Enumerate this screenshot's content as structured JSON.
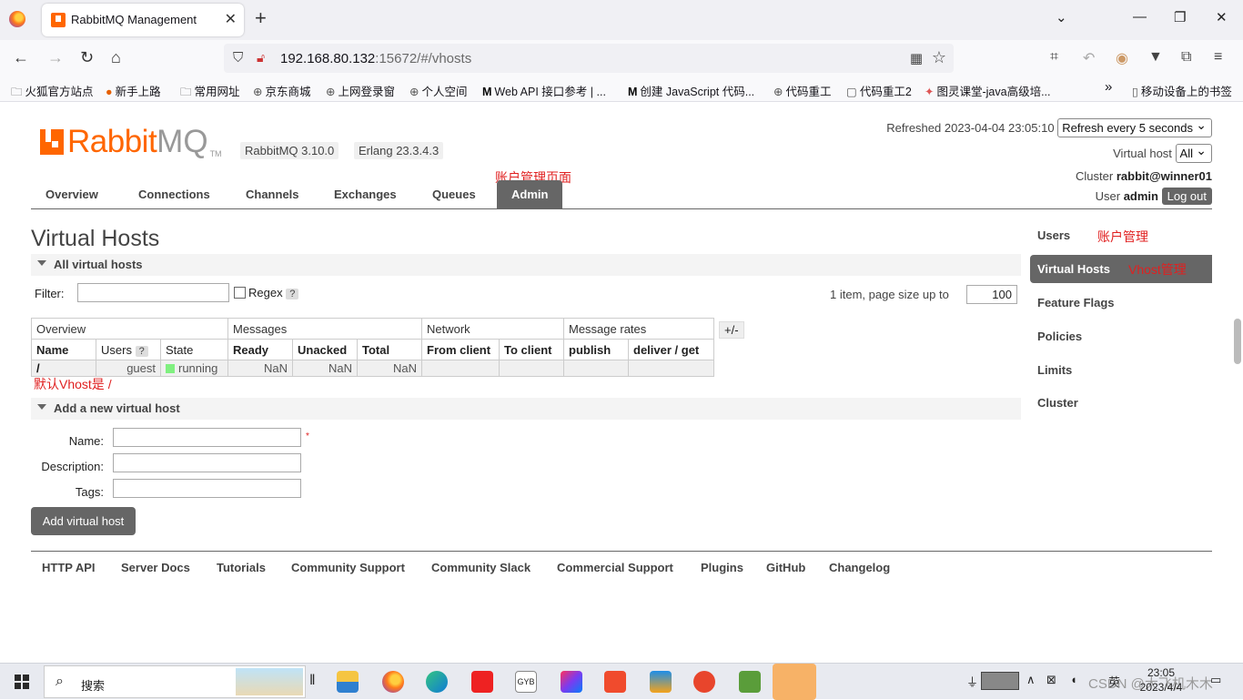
{
  "browser": {
    "tab_title": "RabbitMQ Management",
    "url_host": "192.168.80.132",
    "url_rest": ":15672/#/vhosts"
  },
  "bookmarks": [
    {
      "label": "火狐官方站点",
      "icon": "folder-icon"
    },
    {
      "label": "新手上路",
      "icon": "firefox-icon"
    },
    {
      "label": "常用网址",
      "icon": "folder-icon"
    },
    {
      "label": "京东商城",
      "icon": "globe-icon"
    },
    {
      "label": "上网登录窗",
      "icon": "globe-icon"
    },
    {
      "label": "个人空间",
      "icon": "globe-icon"
    },
    {
      "label": "Web API 接口参考 | ...",
      "icon": "mdn-icon"
    },
    {
      "label": "创建 JavaScript 代码...",
      "icon": "mdn-icon"
    },
    {
      "label": "代码重工",
      "icon": "globe-icon"
    },
    {
      "label": "代码重工2",
      "icon": "page-icon"
    },
    {
      "label": "图灵课堂-java高级培...",
      "icon": "tuling-icon"
    },
    {
      "label": "移动设备上的书签",
      "icon": "mobile-icon"
    }
  ],
  "header": {
    "logo_rabbit": "Rabbit",
    "logo_mq": "MQ",
    "logo_tm": "TM",
    "rabbitmq_version": "RabbitMQ 3.10.0",
    "erlang_version": "Erlang 23.3.4.3",
    "refreshed_label": "Refreshed 2023-04-04 23:05:10",
    "refresh_select": "Refresh every 5 seconds",
    "vhost_label": "Virtual host",
    "vhost_select": "All",
    "cluster_label": "Cluster",
    "cluster_name": "rabbit@winner01",
    "user_label": "User",
    "user_name": "admin",
    "logout": "Log out"
  },
  "nav": [
    "Overview",
    "Connections",
    "Channels",
    "Exchanges",
    "Queues",
    "Admin"
  ],
  "annotations": {
    "admin": "账户管理页面",
    "users": "账户管理",
    "vhosts": "Vhost管理",
    "default_vhost": "默认Vhost是 /"
  },
  "main": {
    "title": "Virtual Hosts",
    "all_section": "All virtual hosts",
    "filter_label": "Filter:",
    "regex_label": "Regex",
    "help": "?",
    "pager_text": "1 item, page size up to",
    "page_size": "100",
    "plus_minus": "+/-",
    "table": {
      "groups": [
        "Overview",
        "Messages",
        "Network",
        "Message rates"
      ],
      "columns": [
        "Name",
        "Users",
        "State",
        "Ready",
        "Unacked",
        "Total",
        "From client",
        "To client",
        "publish",
        "deliver / get"
      ],
      "rows": [
        {
          "name": "/",
          "users": "guest",
          "state": "running",
          "ready": "NaN",
          "unacked": "NaN",
          "total": "NaN"
        }
      ]
    },
    "add_section": "Add a new virtual host",
    "form": {
      "name": "Name:",
      "description": "Description:",
      "tags": "Tags:",
      "required_mark": "*"
    },
    "add_button": "Add virtual host"
  },
  "sidebar": [
    "Users",
    "Virtual Hosts",
    "Feature Flags",
    "Policies",
    "Limits",
    "Cluster"
  ],
  "footer": [
    "HTTP API",
    "Server Docs",
    "Tutorials",
    "Community Support",
    "Community Slack",
    "Commercial Support",
    "Plugins",
    "GitHub",
    "Changelog"
  ],
  "taskbar": {
    "search_placeholder": "搜索",
    "apps": [
      "file-explorer-icon",
      "firefox-icon",
      "edge-icon",
      "youdao-icon",
      "gyb-icon",
      "intellij-icon",
      "xmind-icon",
      "vmware-icon",
      "snail-icon",
      "money-icon",
      "wechat-icon"
    ],
    "tray_lang": "英",
    "watermark": "CSDN @大飞机木木",
    "time": "23:05",
    "date": "2023/4/4"
  },
  "colors": {
    "brand": "#ff6600",
    "nav_active": "#666666",
    "annotation": "#e02020",
    "state_running": "#80f080"
  }
}
